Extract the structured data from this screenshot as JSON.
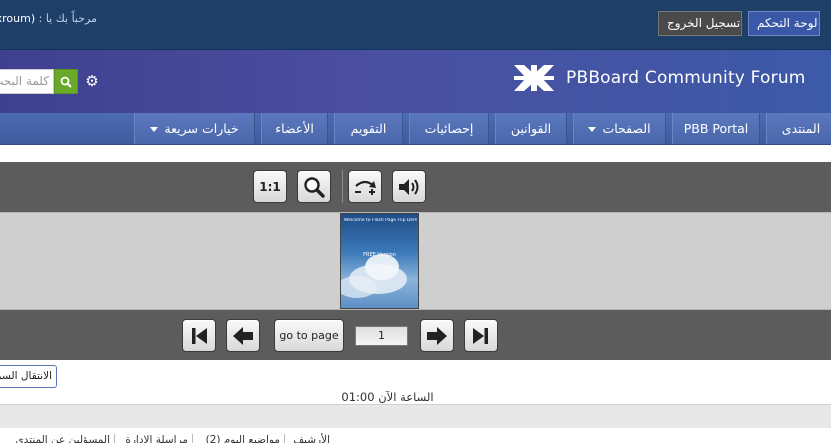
{
  "topbar": {
    "welcome_text": "مرحباً بك يا :",
    "username": "(xroum)",
    "control_panel": "لوحة التحكم",
    "logout": "تسجيل الخروج"
  },
  "header": {
    "site_title": "PBBoard Community Forum",
    "search_placeholder": "كلمة البحث"
  },
  "nav": {
    "items": [
      {
        "label": "المنتدى"
      },
      {
        "label": "PBB Portal"
      },
      {
        "label": "الصفحات"
      },
      {
        "label": "القوانين"
      },
      {
        "label": "إحصائيات"
      },
      {
        "label": "التقويم"
      },
      {
        "label": "الأعضاء"
      },
      {
        "label": "خيارات سريعة"
      }
    ]
  },
  "viewer": {
    "zoom_one_label": "1:1",
    "goto_label": "go to page",
    "page_value": "1",
    "thumb_title": "Welcome to Flash Page Flip Demo",
    "thumb_subtitle": "FREE Version"
  },
  "footer": {
    "jump_button": "الانتقال السريع",
    "time_text": "الساعة الآن 01:00",
    "links": [
      "الأرشيف",
      "مواضيع اليوم (2)",
      "مراسلة الإدارة",
      "المسؤلين عن المنتدى"
    ]
  },
  "colors": {
    "topbar": "#1e3f68",
    "nav": "#4a67ab",
    "search_button": "#6aa82a",
    "viewer_bar": "#5c5c5c"
  }
}
